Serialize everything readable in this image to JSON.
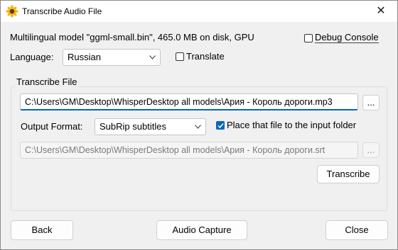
{
  "window": {
    "title": "Transcribe Audio File",
    "close_symbol": "✕"
  },
  "model_info": "Multilingual model \"ggml-small.bin\", 465.0 MB on disk, GPU",
  "debug_console": {
    "label": "Debug Console",
    "checked": false
  },
  "language": {
    "label": "Language:",
    "value": "Russian"
  },
  "translate": {
    "label": "Translate",
    "checked": false
  },
  "transcribe_group": {
    "title": "Transcribe File",
    "input_path": "C:\\Users\\GM\\Desktop\\WhisperDesktop all models\\Ария - Король дороги.mp3",
    "browse_input_label": "...",
    "output_format_label": "Output Format:",
    "output_format_value": "SubRip subtitles",
    "place_in_input_folder": {
      "label": "Place that file to the input folder",
      "checked": true
    },
    "output_path": "C:\\Users\\GM\\Desktop\\WhisperDesktop all models\\Ария - Король дороги.srt",
    "browse_output_label": "...",
    "transcribe_button": "Transcribe"
  },
  "footer": {
    "back": "Back",
    "audio_capture": "Audio Capture",
    "close": "Close"
  },
  "colors": {
    "accent": "#0067c0",
    "background": "#f0f0f0"
  }
}
